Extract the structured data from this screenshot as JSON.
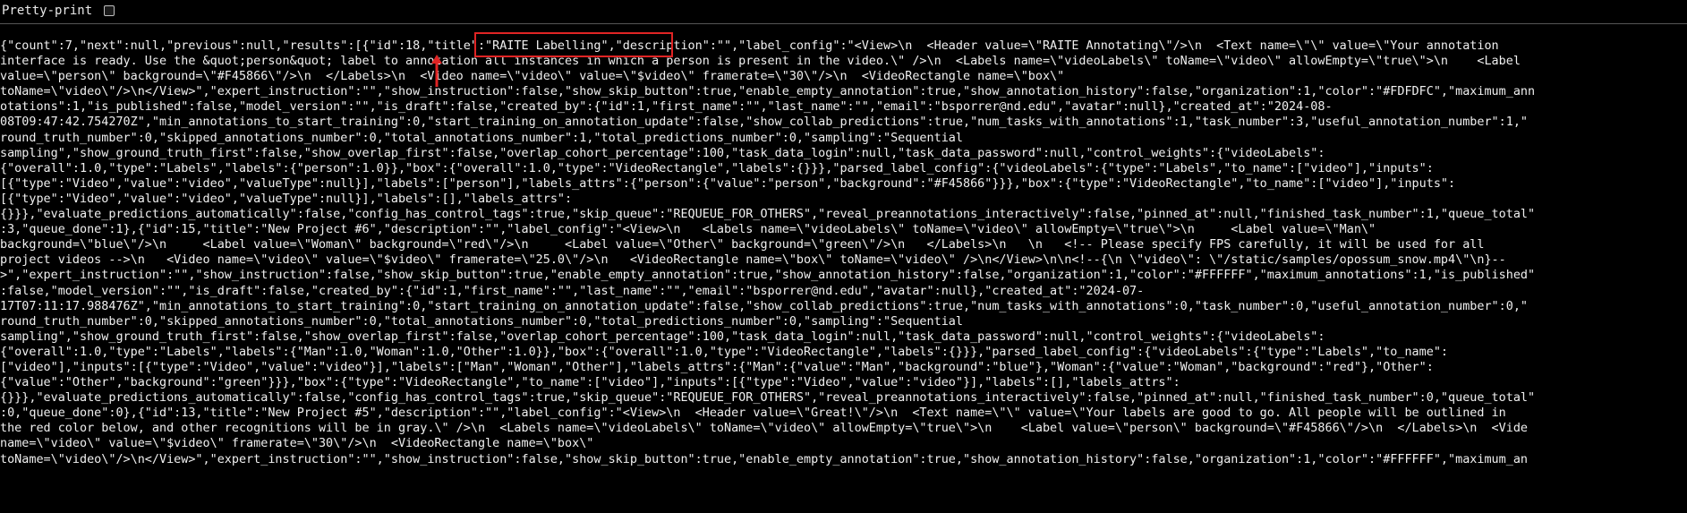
{
  "toolbar": {
    "pretty_print_label": "Pretty-print",
    "pretty_print_checked": false
  },
  "annotation": {
    "highlight_color": "#e02424",
    "highlighted_text": "\"title\":\"RAITE Labelling\""
  },
  "json_lines": [
    "{\"count\":7,\"next\":null,\"previous\":null,\"results\":[{\"id\":18,\"title\":\"RAITE Labelling\",\"description\":\"\",\"label_config\":\"<View>\\n  <Header value=\\\"RAITE Annotating\\\"/>\\n  <Text name=\\\"\\\" value=\\\"Your annotation",
    "interface is ready. Use the &quot;person&quot; label to annotation all instances in which a person is present in the video.\\\" />\\n  <Labels name=\\\"videoLabels\\\" toName=\\\"video\\\" allowEmpty=\\\"true\\\">\\n    <Label",
    "value=\\\"person\\\" background=\\\"#F45866\\\"/>\\n  </Labels>\\n  <Video name=\\\"video\\\" value=\\\"$video\\\" framerate=\\\"30\\\"/>\\n  <VideoRectangle name=\\\"box\\\"",
    "toName=\\\"video\\\"/>\\n</View>\",\"expert_instruction\":\"\",\"show_instruction\":false,\"show_skip_button\":true,\"enable_empty_annotation\":true,\"show_annotation_history\":false,\"organization\":1,\"color\":\"#FDFDFC\",\"maximum_ann",
    "otations\":1,\"is_published\":false,\"model_version\":\"\",\"is_draft\":false,\"created_by\":{\"id\":1,\"first_name\":\"\",\"last_name\":\"\",\"email\":\"bsporrer@nd.edu\",\"avatar\":null},\"created_at\":\"2024-08-",
    "08T09:47:42.754270Z\",\"min_annotations_to_start_training\":0,\"start_training_on_annotation_update\":false,\"show_collab_predictions\":true,\"num_tasks_with_annotations\":1,\"task_number\":3,\"useful_annotation_number\":1,\"",
    "round_truth_number\":0,\"skipped_annotations_number\":0,\"total_annotations_number\":1,\"total_predictions_number\":0,\"sampling\":\"Sequential",
    "sampling\",\"show_ground_truth_first\":false,\"show_overlap_first\":false,\"overlap_cohort_percentage\":100,\"task_data_login\":null,\"task_data_password\":null,\"control_weights\":{\"videoLabels\":",
    "{\"overall\":1.0,\"type\":\"Labels\",\"labels\":{\"person\":1.0}},\"box\":{\"overall\":1.0,\"type\":\"VideoRectangle\",\"labels\":{}}},\"parsed_label_config\":{\"videoLabels\":{\"type\":\"Labels\",\"to_name\":[\"video\"],\"inputs\":",
    "[{\"type\":\"Video\",\"value\":\"video\",\"valueType\":null}],\"labels\":[\"person\"],\"labels_attrs\":{\"person\":{\"value\":\"person\",\"background\":\"#F45866\"}}},\"box\":{\"type\":\"VideoRectangle\",\"to_name\":[\"video\"],\"inputs\":",
    "[{\"type\":\"Video\",\"value\":\"video\",\"valueType\":null}],\"labels\":[],\"labels_attrs\":",
    "{}}},\"evaluate_predictions_automatically\":false,\"config_has_control_tags\":true,\"skip_queue\":\"REQUEUE_FOR_OTHERS\",\"reveal_preannotations_interactively\":false,\"pinned_at\":null,\"finished_task_number\":1,\"queue_total\"",
    ":3,\"queue_done\":1},{\"id\":15,\"title\":\"New Project #6\",\"description\":\"\",\"label_config\":\"<View>\\n   <Labels name=\\\"videoLabels\\\" toName=\\\"video\\\" allowEmpty=\\\"true\\\">\\n     <Label value=\\\"Man\\\"",
    "background=\\\"blue\\\"/>\\n     <Label value=\\\"Woman\\\" background=\\\"red\\\"/>\\n     <Label value=\\\"Other\\\" background=\\\"green\\\"/>\\n   </Labels>\\n   \\n   <!-- Please specify FPS carefully, it will be used for all",
    "project videos -->\\n   <Video name=\\\"video\\\" value=\\\"$video\\\" framerate=\\\"25.0\\\"/>\\n   <VideoRectangle name=\\\"box\\\" toName=\\\"video\\\" />\\n</View>\\n\\n<!--{\\n \\\"video\\\": \\\"/static/samples/opossum_snow.mp4\\\"\\n}--",
    ">\",\"expert_instruction\":\"\",\"show_instruction\":false,\"show_skip_button\":true,\"enable_empty_annotation\":true,\"show_annotation_history\":false,\"organization\":1,\"color\":\"#FFFFFF\",\"maximum_annotations\":1,\"is_published\"",
    ":false,\"model_version\":\"\",\"is_draft\":false,\"created_by\":{\"id\":1,\"first_name\":\"\",\"last_name\":\"\",\"email\":\"bsporrer@nd.edu\",\"avatar\":null},\"created_at\":\"2024-07-",
    "17T07:11:17.988476Z\",\"min_annotations_to_start_training\":0,\"start_training_on_annotation_update\":false,\"show_collab_predictions\":true,\"num_tasks_with_annotations\":0,\"task_number\":0,\"useful_annotation_number\":0,\"",
    "round_truth_number\":0,\"skipped_annotations_number\":0,\"total_annotations_number\":0,\"total_predictions_number\":0,\"sampling\":\"Sequential",
    "sampling\",\"show_ground_truth_first\":false,\"show_overlap_first\":false,\"overlap_cohort_percentage\":100,\"task_data_login\":null,\"task_data_password\":null,\"control_weights\":{\"videoLabels\":",
    "{\"overall\":1.0,\"type\":\"Labels\",\"labels\":{\"Man\":1.0,\"Woman\":1.0,\"Other\":1.0}},\"box\":{\"overall\":1.0,\"type\":\"VideoRectangle\",\"labels\":{}}},\"parsed_label_config\":{\"videoLabels\":{\"type\":\"Labels\",\"to_name\":",
    "[\"video\"],\"inputs\":[{\"type\":\"Video\",\"value\":\"video\"}],\"labels\":[\"Man\",\"Woman\",\"Other\"],\"labels_attrs\":{\"Man\":{\"value\":\"Man\",\"background\":\"blue\"},\"Woman\":{\"value\":\"Woman\",\"background\":\"red\"},\"Other\":",
    "{\"value\":\"Other\",\"background\":\"green\"}}},\"box\":{\"type\":\"VideoRectangle\",\"to_name\":[\"video\"],\"inputs\":[{\"type\":\"Video\",\"value\":\"video\"}],\"labels\":[],\"labels_attrs\":",
    "{}}},\"evaluate_predictions_automatically\":false,\"config_has_control_tags\":true,\"skip_queue\":\"REQUEUE_FOR_OTHERS\",\"reveal_preannotations_interactively\":false,\"pinned_at\":null,\"finished_task_number\":0,\"queue_total\"",
    ":0,\"queue_done\":0},{\"id\":13,\"title\":\"New Project #5\",\"description\":\"\",\"label_config\":\"<View>\\n  <Header value=\\\"Great!\\\"/>\\n  <Text name=\\\"\\\" value=\\\"Your labels are good to go. All people will be outlined in",
    "the red color below, and other recognitions will be in gray.\\\" />\\n  <Labels name=\\\"videoLabels\\\" toName=\\\"video\\\" allowEmpty=\\\"true\\\">\\n    <Label value=\\\"person\\\" background=\\\"#F45866\\\"/>\\n  </Labels>\\n  <Vide",
    "name=\\\"video\\\" value=\\\"$video\\\" framerate=\\\"30\\\"/>\\n  <VideoRectangle name=\\\"box\\\"",
    "toName=\\\"video\\\"/>\\n</View>\",\"expert_instruction\":\"\",\"show_instruction\":false,\"show_skip_button\":true,\"enable_empty_annotation\":true,\"show_annotation_history\":false,\"organization\":1,\"color\":\"#FFFFFF\",\"maximum_an"
  ]
}
